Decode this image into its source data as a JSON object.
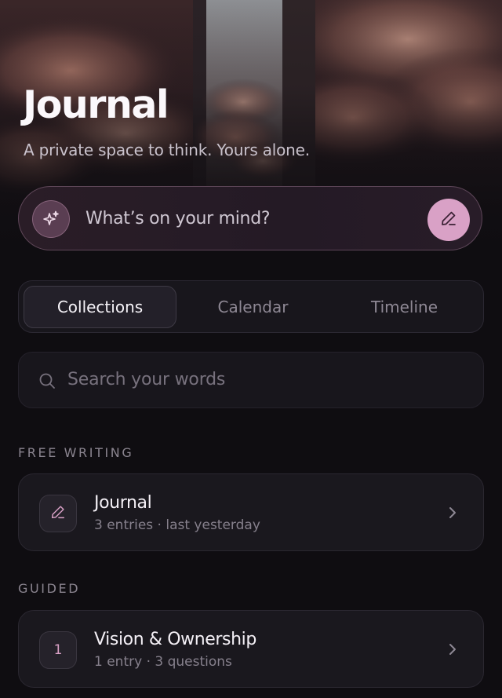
{
  "header": {
    "title": "Journal",
    "subtitle": "A private space to think. Yours alone."
  },
  "compose": {
    "placeholder": "What’s on your mind?",
    "spark_icon": "sparkles-icon",
    "write_icon": "pen-icon"
  },
  "tabs": [
    {
      "label": "Collections",
      "active": true
    },
    {
      "label": "Calendar",
      "active": false
    },
    {
      "label": "Timeline",
      "active": false
    }
  ],
  "search": {
    "placeholder": "Search your words",
    "icon": "search-icon"
  },
  "sections": [
    {
      "label": "FREE WRITING",
      "items": [
        {
          "badge_icon": "pen-icon",
          "title": "Journal",
          "meta": "3 entries · last yesterday"
        }
      ]
    },
    {
      "label": "GUIDED",
      "items": [
        {
          "badge_text": "1",
          "title": "Vision & Ownership",
          "meta": "1 entry · 3 questions"
        }
      ]
    }
  ],
  "colors": {
    "background": "#0f0d11",
    "accent_pink": "#d9a1c6",
    "card": "#1a181e",
    "muted_text": "#86808c"
  }
}
